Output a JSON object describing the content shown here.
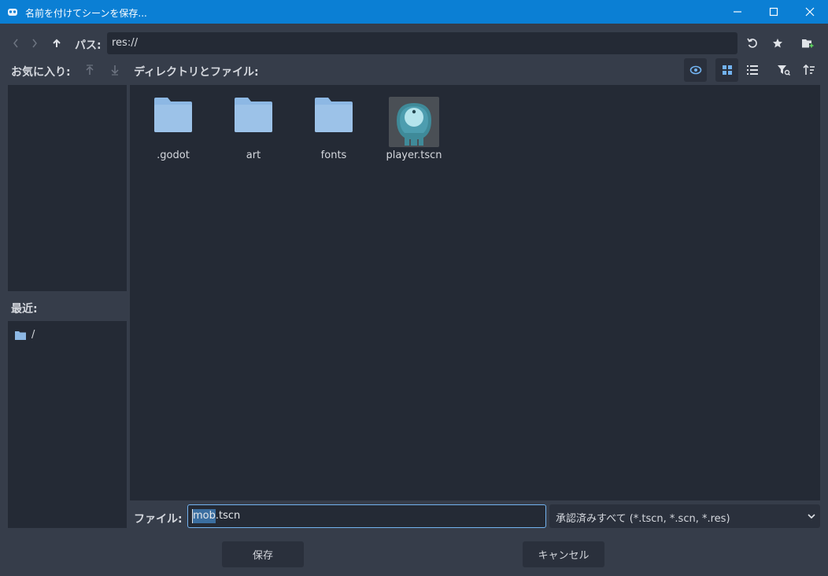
{
  "window": {
    "title": "名前を付けてシーンを保存..."
  },
  "toolbar": {
    "path_label": "パス:",
    "path_value": "res://"
  },
  "favorites": {
    "label": "お気に入り:"
  },
  "recent": {
    "label": "最近:",
    "items": [
      {
        "label": "/"
      }
    ]
  },
  "dir": {
    "label": "ディレクトリとファイル:"
  },
  "files": [
    {
      "name": ".godot",
      "kind": "folder"
    },
    {
      "name": "art",
      "kind": "folder"
    },
    {
      "name": "fonts",
      "kind": "folder"
    },
    {
      "name": "player.tscn",
      "kind": "scene-thumbnail"
    }
  ],
  "file_field": {
    "label": "ファイル:",
    "value": "mob.tscn",
    "selected_part": "mob"
  },
  "filter": {
    "selected": "承認済みすべて (*.tscn, *.scn, *.res)"
  },
  "buttons": {
    "save": "保存",
    "cancel": "キャンセル"
  },
  "colors": {
    "titlebar": "#0b7fd4",
    "folder": "#8db8e4",
    "accent": "#72b2ef",
    "panel": "#242a35",
    "background": "#363d4a"
  }
}
